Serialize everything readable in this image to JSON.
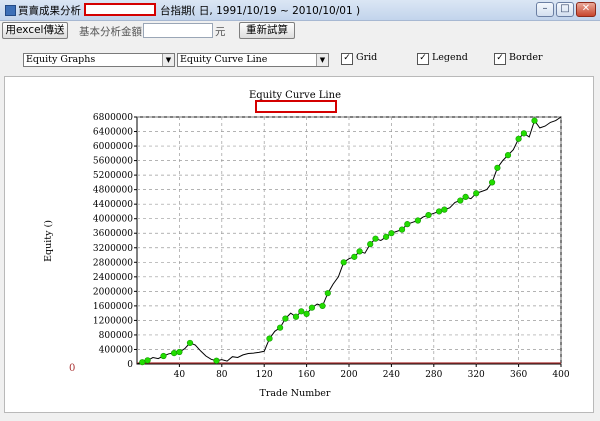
{
  "window": {
    "title": "買賣成果分析 -",
    "subtitle": "台指期( 日, 1991/10/19 ~ 2010/10/01 )",
    "buttons": {
      "minimize": "–",
      "maximize": "□",
      "close": "✕"
    }
  },
  "toolbar": {
    "export_label": "用excel傳送",
    "base_amount_label": "基本分析金額",
    "base_amount_value": "",
    "unit": "元",
    "recalc_label": "重新試算"
  },
  "controls": {
    "graph_select": "Equity Graphs",
    "curve_select": "Equity Curve Line",
    "grid": {
      "label": "Grid",
      "checked": true
    },
    "legend": {
      "label": "Legend",
      "checked": true
    },
    "border": {
      "label": "Border",
      "checked": true
    }
  },
  "colors": {
    "line": "#000000",
    "marker": "#22dd00",
    "zero_line": "#aa3333",
    "redact_border": "#d40000"
  },
  "chart_data": {
    "type": "line",
    "title": "Equity Curve Line",
    "xlabel": "Trade Number",
    "ylabel": "Equity ()",
    "xlim": [
      0,
      400
    ],
    "ylim": [
      0,
      6800000
    ],
    "xticks": [
      40,
      80,
      120,
      160,
      200,
      240,
      280,
      320,
      360,
      400
    ],
    "yticks": [
      400000,
      800000,
      1200000,
      1600000,
      2000000,
      2400000,
      2800000,
      3200000,
      3600000,
      4000000,
      4400000,
      4800000,
      5200000,
      5600000,
      6000000,
      6400000,
      6800000
    ],
    "secondary_axis_label": "0",
    "series": [
      {
        "x": [
          0,
          5,
          10,
          15,
          20,
          25,
          30,
          35,
          40,
          45,
          50,
          55,
          60,
          65,
          70,
          75,
          80,
          85,
          90,
          95,
          100,
          105,
          110,
          115,
          120,
          125,
          130,
          135,
          140,
          145,
          150,
          155,
          160,
          165,
          170,
          175,
          180,
          185,
          190,
          195,
          200,
          205,
          210,
          215,
          220,
          225,
          230,
          235,
          240,
          245,
          250,
          255,
          260,
          265,
          270,
          275,
          280,
          285,
          290,
          295,
          300,
          305,
          310,
          315,
          320,
          325,
          330,
          335,
          340,
          345,
          350,
          355,
          360,
          365,
          370,
          375,
          380,
          385,
          390,
          395,
          400
        ],
        "values": [
          0,
          50000,
          100000,
          180000,
          150000,
          220000,
          280000,
          300000,
          330000,
          420000,
          580000,
          520000,
          360000,
          220000,
          130000,
          90000,
          120000,
          80000,
          200000,
          180000,
          250000,
          290000,
          300000,
          320000,
          350000,
          700000,
          900000,
          1000000,
          1250000,
          1400000,
          1300000,
          1450000,
          1380000,
          1550000,
          1650000,
          1600000,
          1950000,
          2200000,
          2400000,
          2800000,
          2900000,
          2950000,
          3100000,
          3050000,
          3300000,
          3450000,
          3400000,
          3500000,
          3600000,
          3650000,
          3700000,
          3850000,
          3900000,
          3950000,
          4050000,
          4100000,
          4150000,
          4200000,
          4250000,
          4300000,
          4450000,
          4500000,
          4600000,
          4550000,
          4700000,
          4750000,
          4800000,
          5000000,
          5400000,
          5600000,
          5750000,
          5900000,
          6200000,
          6350000,
          6250000,
          6700000,
          6500000,
          6550000,
          6650000,
          6700000,
          6800000
        ]
      }
    ],
    "marker_indices": [
      1,
      2,
      5,
      7,
      8,
      10,
      15,
      25,
      27,
      28,
      30,
      31,
      32,
      33,
      35,
      36,
      39,
      41,
      42,
      44,
      45,
      47,
      48,
      50,
      51,
      53,
      55,
      57,
      58,
      61,
      62,
      64,
      67,
      68,
      70,
      72,
      73,
      75
    ]
  }
}
